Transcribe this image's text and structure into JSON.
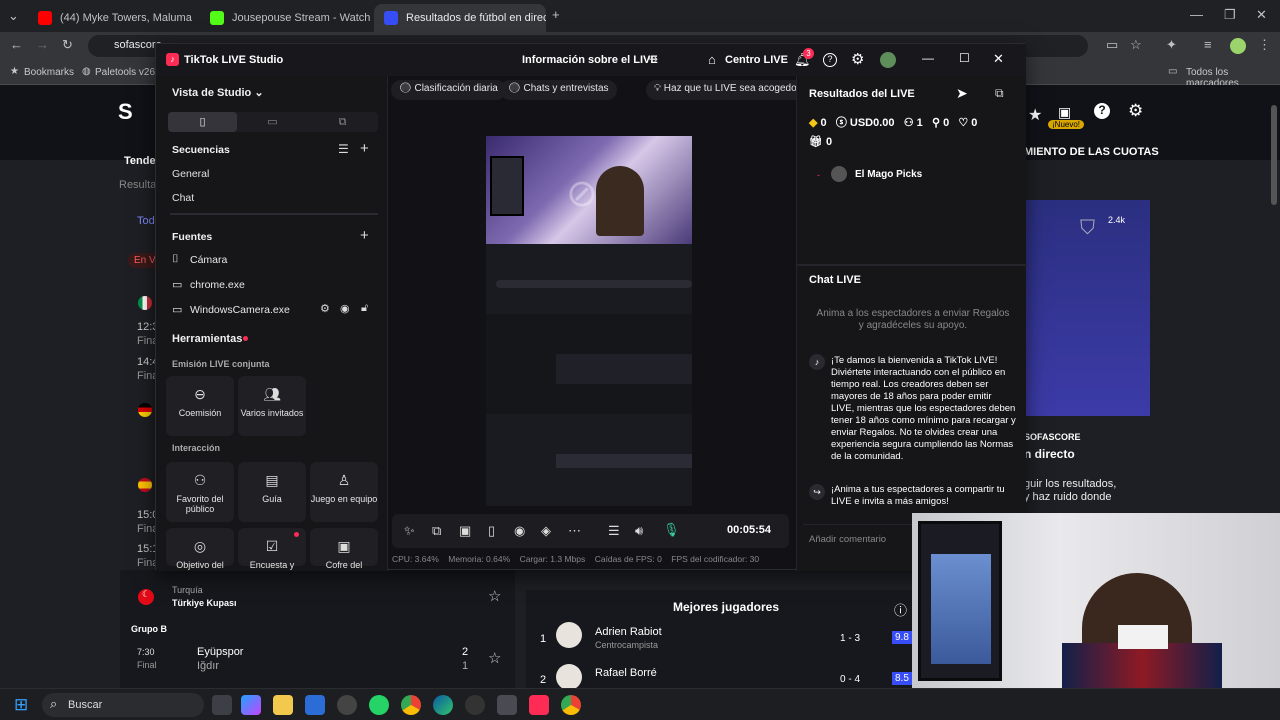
{
  "browser": {
    "tabs": [
      {
        "label": "(44) Myke Towers, Maluma",
        "color": "#ff0000"
      },
      {
        "label": "Jousepouse Stream - Watch Liv",
        "color": "#53fc18"
      },
      {
        "label": "Resultados de fútbol en directo",
        "color": "#374df5"
      }
    ],
    "address": "sofascore",
    "bookmarks": [
      "Bookmarks",
      "Paletools v26.0"
    ],
    "all_bookmarks": "Todos los marcadores"
  },
  "sofa": {
    "crumb": "Resultad",
    "tab": "Tod",
    "live": "En V",
    "times": [
      "12:3",
      "Final",
      "14:4",
      "Final",
      "15:0",
      "Final",
      "15:1",
      "Final"
    ],
    "trend": "Tenden",
    "cuotas": "MIENTO DE LAS CUOTAS",
    "count": "2.4k",
    "nuevo": "¡Nuevo!",
    "brand": "SOFASCORE",
    "directo": "n directo",
    "promo": "guir los resultados, y haz ruido donde",
    "country": "Turquía",
    "comp": "Türkiye Kupası",
    "group": "Grupo B",
    "match": {
      "time": "7:30",
      "status": "Final",
      "home": "Eyüpspor",
      "away": "Iğdır",
      "hs": "2",
      "as": "1"
    },
    "best": "Mejores jugadores",
    "players": [
      {
        "rank": "1",
        "name": "Adrien Rabiot",
        "pos": "Centrocampista",
        "score": "1 - 3",
        "rating": "9.8"
      },
      {
        "rank": "2",
        "name": "Rafael Borré",
        "pos": "",
        "score": "0 - 4",
        "rating": "8.5"
      }
    ]
  },
  "tiktok": {
    "app": "TikTok LIVE Studio",
    "info": "Información sobre el LIVE",
    "center": "Centro LIVE",
    "notif": "3",
    "studio_view": "Vista de Studio",
    "sequences": "Secuencias",
    "seq": [
      "General",
      "Chat"
    ],
    "sources": "Fuentes",
    "src": [
      "Cámara",
      "chrome.exe",
      "WindowsCamera.exe"
    ],
    "tools": "Herramientas",
    "joint": "Emisión LIVE conjunta",
    "joint_tiles": [
      "Coemisión",
      "Varios invitados"
    ],
    "interaction": "Interacción",
    "inter_tiles": [
      "Favorito del público",
      "Guía",
      "Juego en equipo"
    ],
    "more_tiles": [
      "Objetivo del",
      "Encuesta y",
      "Cofre del"
    ],
    "pills": [
      "Clasificación diaria",
      "Chats y entrevistas",
      "Haz que tu LIVE sea acogedor"
    ],
    "timer": "00:05:54",
    "stats": {
      "cpu": "CPU: 3.64%",
      "mem": "Memoria: 0.64%",
      "load": "Cargar: 1.3 Mbps",
      "fps": "Caídas de FPS: 0",
      "enc": "FPS del codificador: 30"
    },
    "results": "Resultados del LIVE",
    "r": {
      "coins": "0",
      "usd": "USD0.00",
      "viewers": "1",
      "follows": "0",
      "likes": "0",
      "gifts": "0"
    },
    "magic": "El Mago Picks",
    "chat": "Chat LIVE",
    "chat_hint": "Anima a los espectadores a enviar Regalos y agradéceles su apoyo.",
    "welcome": "¡Te damos la bienvenida a TikTok LIVE! Diviértete interactuando con el público en tiempo real. Los creadores deben ser mayores de 18 años para poder emitir LIVE, mientras que los espectadores deben tener 18 años como mínimo para recargar y enviar Regalos. No te olvides crear una experiencia segura cumpliendo las Normas de la comunidad.",
    "share": "¡Anima a tus espectadores a compartir tu LIVE e invita a más amigos!",
    "comment_ph": "Añadir comentario"
  },
  "taskbar": {
    "search": "Buscar"
  }
}
